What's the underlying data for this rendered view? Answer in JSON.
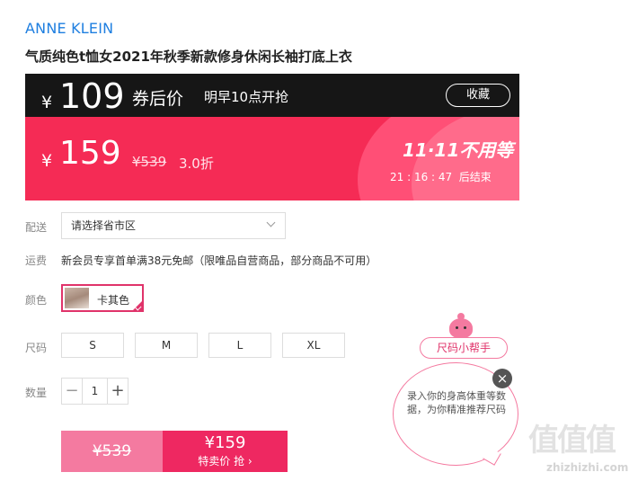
{
  "product": {
    "brand": "ANNE KLEIN",
    "title": "气质纯色t恤女2021年秋季新款修身休闲长袖打底上衣"
  },
  "promo": {
    "coupon_currency": "¥",
    "coupon_price": "109",
    "coupon_label": "券后价",
    "start_text": "明早10点开抢",
    "collect_label": "收藏",
    "currency": "¥",
    "price": "159",
    "original_price": "¥539",
    "discount": "3.0折",
    "sale_title": "11·11不用等",
    "countdown": "21 : 16 : 47  后结束",
    "colors": {
      "dark": "#161616",
      "accent": "#f52b55"
    }
  },
  "delivery": {
    "label": "配送",
    "placeholder": "请选择省市区"
  },
  "shipping": {
    "label": "运费",
    "text": "新会员专享首单满38元免邮（限唯品自营商品，部分商品不可用）"
  },
  "color": {
    "label": "颜色",
    "selected": "卡其色"
  },
  "size": {
    "label": "尺码",
    "options": [
      "S",
      "M",
      "L",
      "XL"
    ]
  },
  "quantity": {
    "label": "数量",
    "minus": "−",
    "value": "1",
    "plus": "+"
  },
  "buy": {
    "original_price": "¥539",
    "price": "¥159",
    "action": "特卖价 抢 ›"
  },
  "size_helper": {
    "title": "尺码小帮手",
    "bubble_text": "录入你的身高体重等数据，为你精准推荐尺码",
    "close": "×"
  },
  "watermark": {
    "logo": "值值值",
    "url": "zhizhizhi.com"
  }
}
